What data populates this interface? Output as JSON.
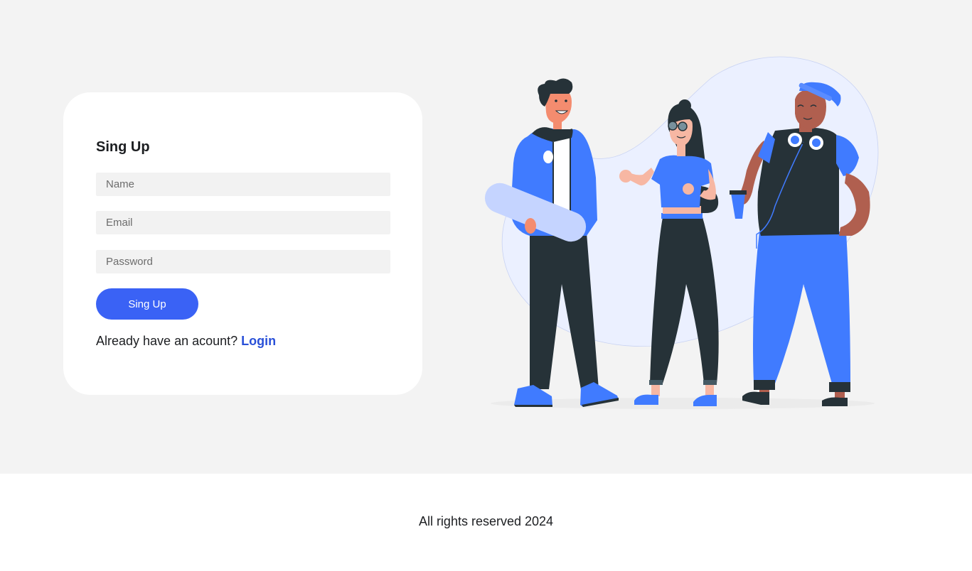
{
  "form": {
    "title": "Sing Up",
    "name_placeholder": "Name",
    "email_placeholder": "Email",
    "password_placeholder": "Password",
    "submit_label": "Sing Up",
    "login_prompt": "Already have an acount?",
    "login_link": "Login"
  },
  "illustration": {
    "icon": "people-group-illustration"
  },
  "footer": {
    "text": "All rights reserved 2024"
  },
  "colors": {
    "accent": "#3a62f5",
    "link": "#2950d8",
    "background": "#f3f3f3",
    "card": "#ffffff",
    "illustration_blue": "#407bff",
    "illustration_dark": "#263238"
  }
}
